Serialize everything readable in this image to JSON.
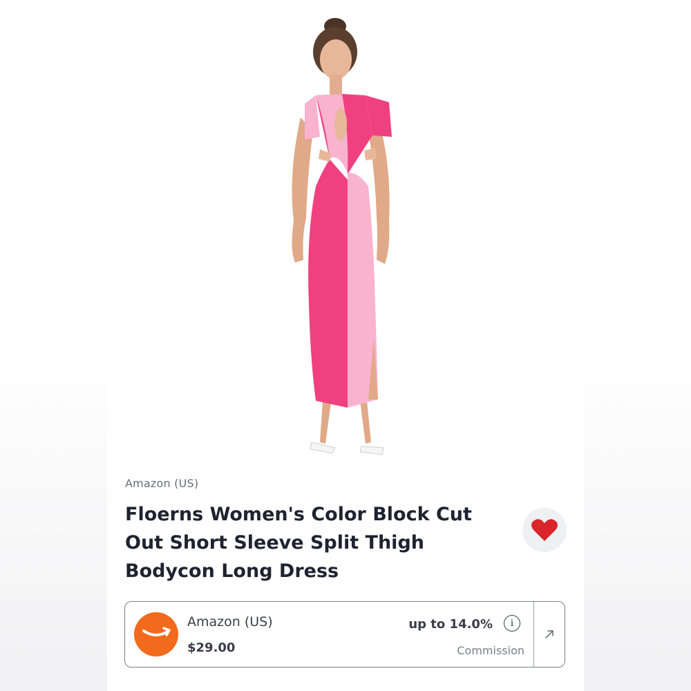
{
  "product": {
    "store": "Amazon (US)",
    "title": "Floerns Women's Color Block Cut Out Short Sleeve Split Thigh Bodycon Long Dress",
    "favorite_icon": "heart-icon",
    "image_icon": "product-photo"
  },
  "offer": {
    "retailer": "Amazon (US)",
    "price": "$29.00",
    "commission_rate": "up to 14.0%",
    "commission_label": "Commission",
    "info_icon_glyph": "i",
    "link_icon": "arrow-up-right-icon"
  },
  "colors": {
    "heart": "#d9262b",
    "retailer_logo": "#f26a1b",
    "dress_hot_pink": "#f0407f",
    "dress_light_pink": "#f9b3cf"
  }
}
